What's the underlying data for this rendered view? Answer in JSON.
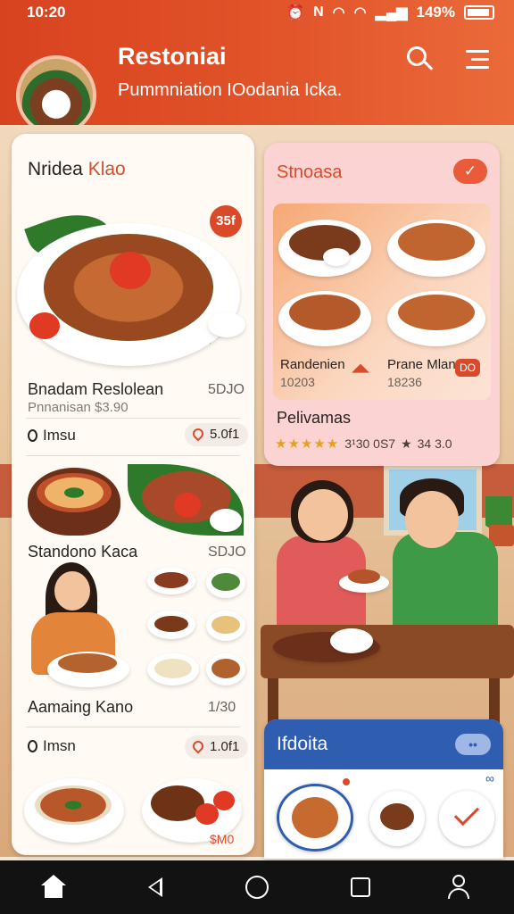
{
  "status_bar": {
    "time": "10:20",
    "icons": [
      "alarm-icon",
      "nfc-icon",
      "wifi-icon",
      "wifi-icon",
      "signal-icon"
    ],
    "battery": "149%"
  },
  "header": {
    "title": "Restoniai",
    "subtitle": "Pummniation IOodania Icka.",
    "accent_color": "#d8431f"
  },
  "left_card": {
    "section1_title_a": "Nridea ",
    "section1_title_b": "Klao",
    "hero_badge": "35f",
    "item1": {
      "name": "Bnadam Reslolean",
      "price": "5DJO",
      "sub": "Pnnanisan $3.90"
    },
    "loc1": {
      "label": "Imsu",
      "pill": "5.0f1"
    },
    "item2": {
      "name": "Standono Kaca",
      "price": "SDJO"
    },
    "item3": {
      "name": "Aamaing Kano",
      "price": "1/30"
    },
    "loc2": {
      "label": "Imsn",
      "pill": "1.0f1"
    },
    "bottom_price": "$M0"
  },
  "right_top_card": {
    "title": "Stnoasa",
    "check_icon": "check-icon",
    "dish1": {
      "name": "Randenien",
      "code": "10203"
    },
    "dish2": {
      "name": "Prane Mlan",
      "code": "18236",
      "badge": "DO"
    },
    "reviews_label": "Pelivamas",
    "rating_stars": "★★★★★",
    "rating_a": "3¹30 0S7",
    "rating_b": "34 3.0",
    "star_color": "#e6a21c"
  },
  "right_bottom_card": {
    "title": "Ifdoita",
    "chip": "••",
    "handle": "∞",
    "header_color": "#2f5db0"
  },
  "nav_bar": {
    "items": [
      "home-icon",
      "back-icon",
      "home-circle-icon",
      "recents-icon",
      "contacts-icon"
    ]
  }
}
